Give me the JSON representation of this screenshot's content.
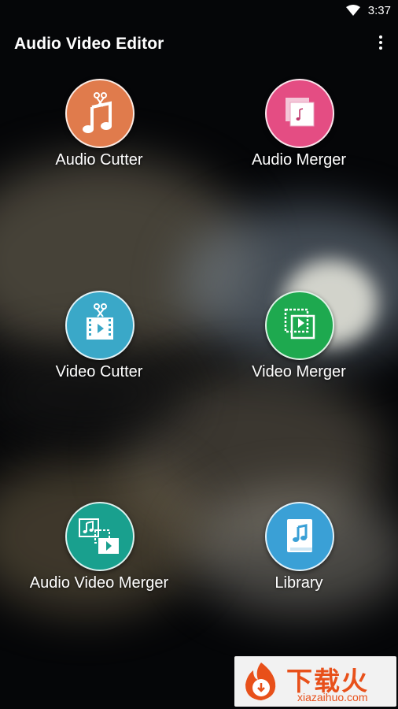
{
  "status_bar": {
    "time": "3:37"
  },
  "app_bar": {
    "title": "Audio Video Editor"
  },
  "tiles": [
    {
      "label": "Audio Cutter",
      "icon": "music-scissors-icon",
      "color": "#e07b4c"
    },
    {
      "label": "Audio Merger",
      "icon": "music-merge-icon",
      "color": "#e44d83"
    },
    {
      "label": "Video Cutter",
      "icon": "video-scissors-icon",
      "color": "#3aa8c8"
    },
    {
      "label": "Video Merger",
      "icon": "video-merge-icon",
      "color": "#1ea94f"
    },
    {
      "label": "Audio Video Merger",
      "icon": "audio-video-merge-icon",
      "color": "#19a08e"
    },
    {
      "label": "Library",
      "icon": "music-book-icon",
      "color": "#3aa0d6"
    }
  ],
  "watermark": {
    "text": "下载火",
    "url": "xiazaihuo.com"
  }
}
